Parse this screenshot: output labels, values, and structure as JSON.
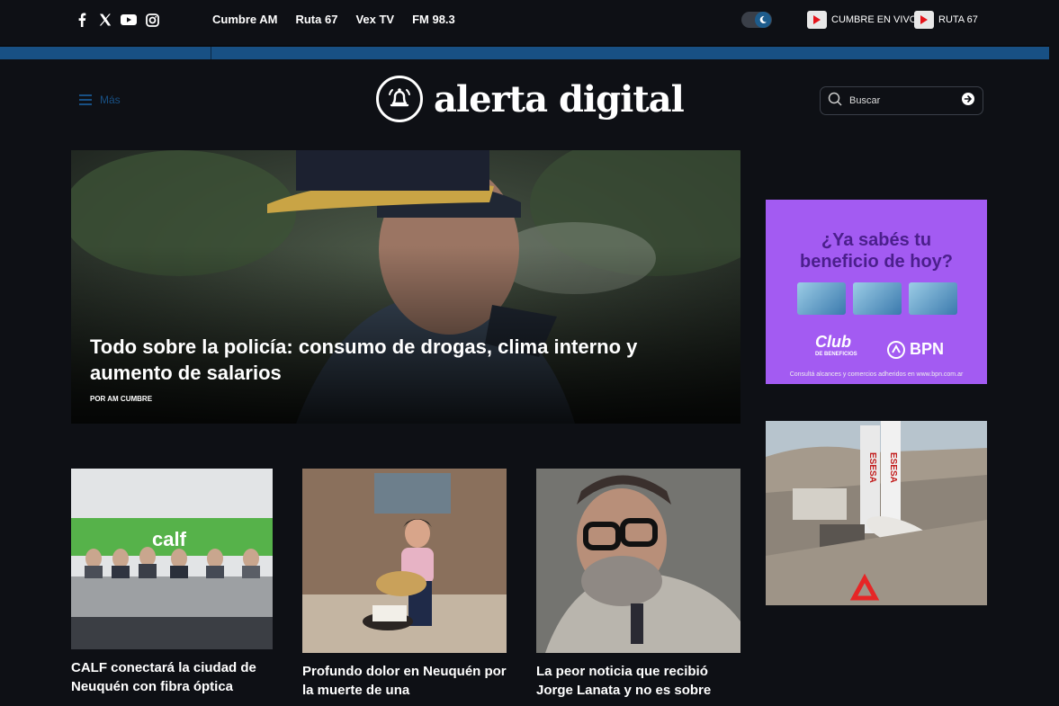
{
  "topbar": {
    "social_icons": [
      "facebook-icon",
      "x-icon",
      "youtube-icon",
      "instagram-icon"
    ],
    "nav": [
      "Cumbre AM",
      "Ruta 67",
      "Vex TV",
      "FM 98.3"
    ],
    "live_links": [
      "CUMBRE EN VIVO",
      "RUTA 67"
    ]
  },
  "header": {
    "menu_label": "Más",
    "logo_text": "alerta digital",
    "search_placeholder": "Buscar"
  },
  "hero": {
    "title": "Todo sobre la policía: consumo de drogas, clima interno y aumento de salarios",
    "byline": "POR AM CUMBRE"
  },
  "articles": [
    {
      "title": "CALF conectará la ciudad de Neuquén con fibra óptica"
    },
    {
      "title": "Profundo dolor en Neuquén por la muerte de una"
    },
    {
      "title": "La peor noticia que recibió Jorge Lanata y no es sobre"
    }
  ],
  "ads": {
    "ad1_headline_1": "¿Ya sabés tu",
    "ad1_headline_2": "beneficio de hoy?",
    "ad1_club": "Club",
    "ad1_club_sub": "DE BENEFICIOS",
    "ad1_bank": "BPN",
    "ad1_footer": "Consultá alcances y comercios adheridos en www.bpn.com.ar",
    "ad2_brand": "ESESA"
  },
  "colors": {
    "accent": "#185084",
    "background": "#0e1015",
    "ad_purple": "#a35bf2"
  }
}
